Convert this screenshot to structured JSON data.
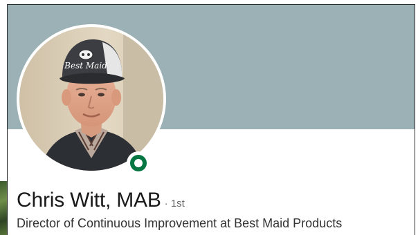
{
  "profile": {
    "name": "Chris Witt, MAB",
    "degree_separator": "·",
    "degree": "1st",
    "headline": "Director of Continuous Improvement at Best Maid Products",
    "online": true
  },
  "avatar": {
    "cap_text": "Best Maid"
  },
  "colors": {
    "banner": "#9cb1b5",
    "presence": "#057642",
    "name_text": "#191919",
    "meta_text": "#666666"
  }
}
